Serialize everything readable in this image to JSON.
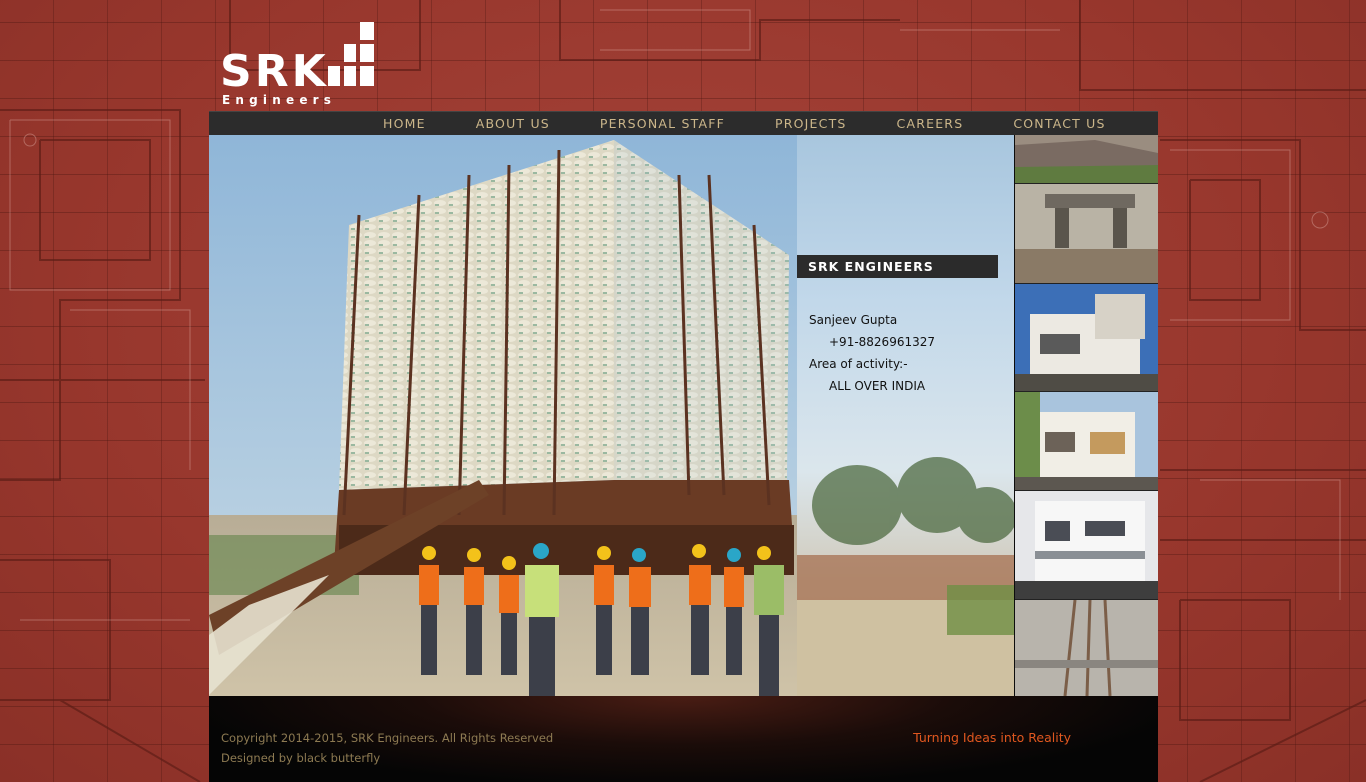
{
  "logo": {
    "word": "SRK",
    "subtitle": "Engineers"
  },
  "nav": {
    "items": [
      "HOME",
      "ABOUT US",
      "PERSONAL STAFF",
      "PROJECTS",
      "CAREERS",
      "CONTACT US"
    ]
  },
  "info": {
    "title": "SRK ENGINEERS",
    "name": "Sanjeev Gupta",
    "phone": "+91-8826961327",
    "area_label": "Area of activity:-",
    "area_value": "ALL OVER INDIA"
  },
  "footer": {
    "copyright": "Copyright 2014-2015, SRK Engineers. All Rights Reserved",
    "designer": "Designed by black butterfly",
    "tagline": "Turning Ideas into Reality"
  },
  "colors": {
    "background": "#9b3a30",
    "nav_text": "#cbb68a",
    "tagline": "#e0571f"
  }
}
